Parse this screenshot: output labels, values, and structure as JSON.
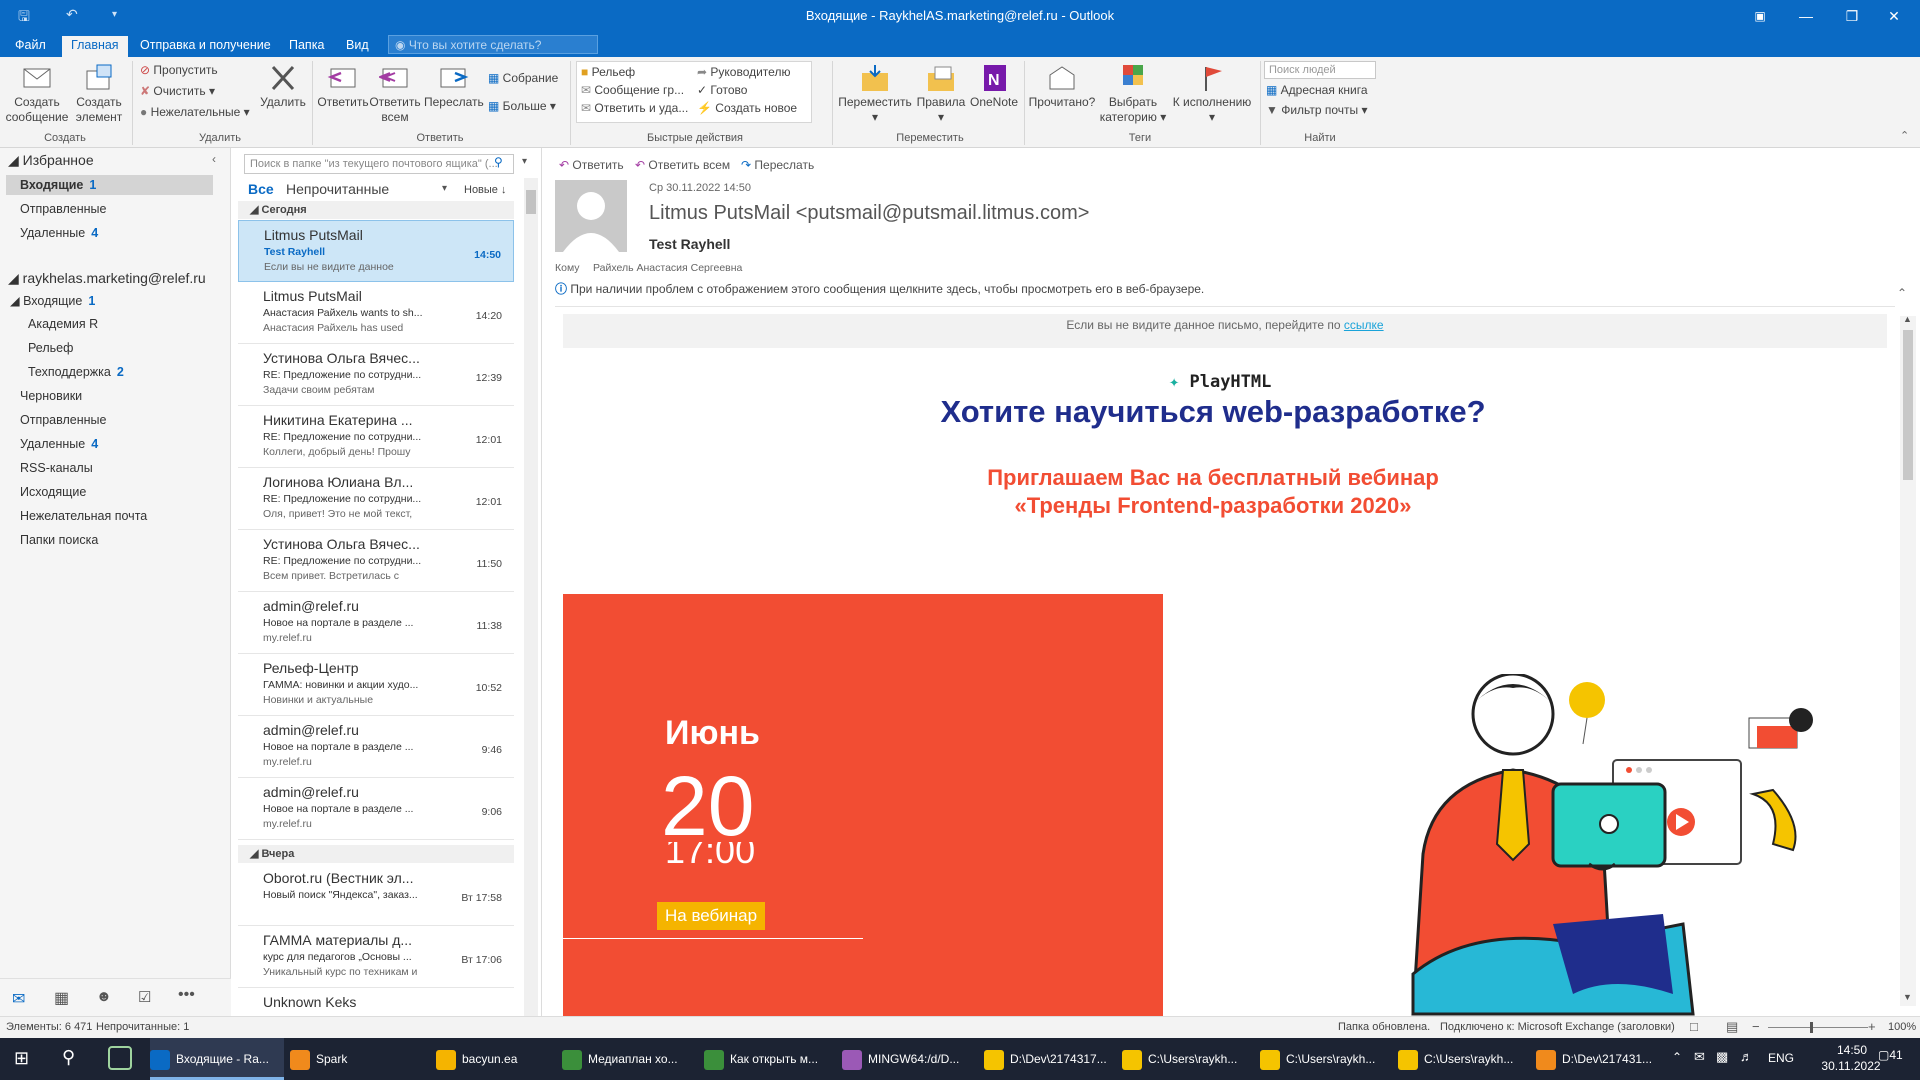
{
  "window": {
    "title": "Входящие - RaykhelAS.marketing@relef.ru - Outlook"
  },
  "tabs": [
    "Файл",
    "Главная",
    "Отправка и получение",
    "Папка",
    "Вид"
  ],
  "tell_me": "Что вы хотите сделать?",
  "ribbon": {
    "new_email": "Создать\nсообщение",
    "new_items": "Создать\nэлемент",
    "ignore": "Пропустить",
    "clean_up": "Очистить",
    "junk": "Нежелательные",
    "delete": "Удалить",
    "reply": "Ответить",
    "reply_all": "Ответить\nвсем",
    "forward": "Переслать",
    "meeting": "Собрание",
    "more": "Больше",
    "qs_relef": "Рельеф",
    "qs_team": "Сообщение гр...",
    "qs_reply_delete": "Ответить и уда...",
    "qs_manager": "Руководителю",
    "qs_done": "Готово",
    "qs_create_new": "Создать новое",
    "move": "Переместить",
    "rules": "Правила",
    "onenote": "OneNote",
    "unread_read": "Прочитано?",
    "categorize": "Выбрать\nкатегорию",
    "follow_up": "К исполнению",
    "search_people": "Поиск людей",
    "address_book": "Адресная книга",
    "filter_email": "Фильтр почты",
    "groups": {
      "create": "Создать",
      "delete": "Удалить",
      "respond": "Ответить",
      "quick_steps": "Быстрые действия",
      "move": "Переместить",
      "tags": "Теги",
      "find": "Найти"
    }
  },
  "folders": {
    "favorites_header": "Избранное",
    "favorites": [
      {
        "name": "Входящие",
        "count": "1"
      },
      {
        "name": "Отправленные",
        "count": ""
      },
      {
        "name": "Удаленные",
        "count": "4"
      }
    ],
    "account": "raykhelas.marketing@relef.ru",
    "inbox": {
      "name": "Входящие",
      "count": "1"
    },
    "subfolders": [
      {
        "name": "Академия R",
        "count": ""
      },
      {
        "name": "Рельеф",
        "count": ""
      },
      {
        "name": "Техподдержка",
        "count": "2"
      }
    ],
    "others": [
      {
        "name": "Черновики",
        "count": ""
      },
      {
        "name": "Отправленные",
        "count": ""
      },
      {
        "name": "Удаленные",
        "count": "4"
      },
      {
        "name": "RSS-каналы",
        "count": ""
      },
      {
        "name": "Исходящие",
        "count": ""
      },
      {
        "name": "Нежелательная почта",
        "count": ""
      },
      {
        "name": "Папки поиска",
        "count": ""
      }
    ]
  },
  "msglist": {
    "search_placeholder": "Поиск в папке \"из текущего почтового ящика\" (...",
    "filter_all": "Все",
    "filter_unread": "Непрочитанные",
    "sort": "Новые",
    "group_today": "Сегодня",
    "group_yesterday": "Вчера",
    "messages": [
      {
        "from": "Litmus PutsMail",
        "subject": "Test Rayhell",
        "preview": "Если вы не видите данное",
        "time": "14:50"
      },
      {
        "from": "Litmus PutsMail",
        "subject": "Анастасия Райхель wants to sh...",
        "preview": "Анастасия Райхель has used",
        "time": "14:20"
      },
      {
        "from": "Устинова Ольга Вячес...",
        "subject": "RE: Предложение по сотрудни...",
        "preview": "Задачи своим ребятам",
        "time": "12:39"
      },
      {
        "from": "Никитина Екатерина ...",
        "subject": "RE: Предложение по сотрудни...",
        "preview": "Коллеги, добрый день!  Прошу",
        "time": "12:01"
      },
      {
        "from": "Логинова Юлиана Вл...",
        "subject": "RE: Предложение по сотрудни...",
        "preview": "Оля, привет!  Это не мой текст,",
        "time": "12:01"
      },
      {
        "from": "Устинова Ольга Вячес...",
        "subject": "RE: Предложение по сотрудни...",
        "preview": "Всем привет.  Встретилась с",
        "time": "11:50"
      },
      {
        "from": "admin@relef.ru",
        "subject": "Новое на портале в разделе ...",
        "preview": "my.relef.ru",
        "time": "11:38"
      },
      {
        "from": "Рельеф-Центр",
        "subject": "ГАММА: новинки и акции худо...",
        "preview": "Новинки и актуальные",
        "time": "10:52"
      },
      {
        "from": "admin@relef.ru",
        "subject": "Новое на портале в разделе ...",
        "preview": "my.relef.ru",
        "time": "9:46"
      },
      {
        "from": "admin@relef.ru",
        "subject": "Новое на портале в разделе ...",
        "preview": "my.relef.ru",
        "time": "9:06"
      }
    ],
    "yesterday": [
      {
        "from": "Oborot.ru (Вестник эл...",
        "subject": "Новый поиск \"Яндекса\", заказ...",
        "preview": "",
        "time": "Вт 17:58"
      },
      {
        "from": "ГАММА материалы д...",
        "subject": "курс для педагогов „Основы ...",
        "preview": "Уникальный курс по техникам и",
        "time": "Вт 17:06"
      },
      {
        "from": "Unknown Keks",
        "subject": "",
        "preview": "",
        "time": ""
      }
    ]
  },
  "reading": {
    "actions": [
      "Ответить",
      "Ответить всем",
      "Переслать"
    ],
    "date": "Ср 30.11.2022 14:50",
    "sender": "Litmus PutsMail <putsmail@putsmail.litmus.com>",
    "subject": "Test Rayhell",
    "to_label": "Кому",
    "to": "Райхель Анастасия Сергеевна",
    "info": "При наличии проблем с отображением этого сообщения щелкните здесь, чтобы просмотреть его в веб-браузере.",
    "banner_text": "Если вы не видите данное письмо, перейдите по",
    "banner_link": "ссылке",
    "brand": "PlayHTML",
    "headline": "Хотите научиться web-разработке?",
    "subhead": "Приглашаем Вас на бесплатный вебинар «Тренды Frontend-разработки 2020»",
    "month": "Июнь",
    "day": "20",
    "time": "17:00",
    "cta": "На вебинар"
  },
  "statusbar": {
    "items": "Элементы: 6 471",
    "unread": "Непрочитанные: 1",
    "folder_updated": "Папка обновлена.",
    "connected": "Подключено к: Microsoft Exchange (заголовки)",
    "zoom": "100%"
  },
  "taskbar": {
    "apps": [
      "Входящие - Ra...",
      "Spark",
      "bacyun.ea",
      "Медиаплан хо...",
      "Как открыть м...",
      "MINGW64:/d/D...",
      "D:\\Dev\\2174317...",
      "C:\\Users\\raykh...",
      "C:\\Users\\raykh...",
      "C:\\Users\\raykh...",
      "D:\\Dev\\217431..."
    ],
    "lang": "ENG",
    "time": "14:50",
    "date": "30.11.2022",
    "notif": "41"
  }
}
